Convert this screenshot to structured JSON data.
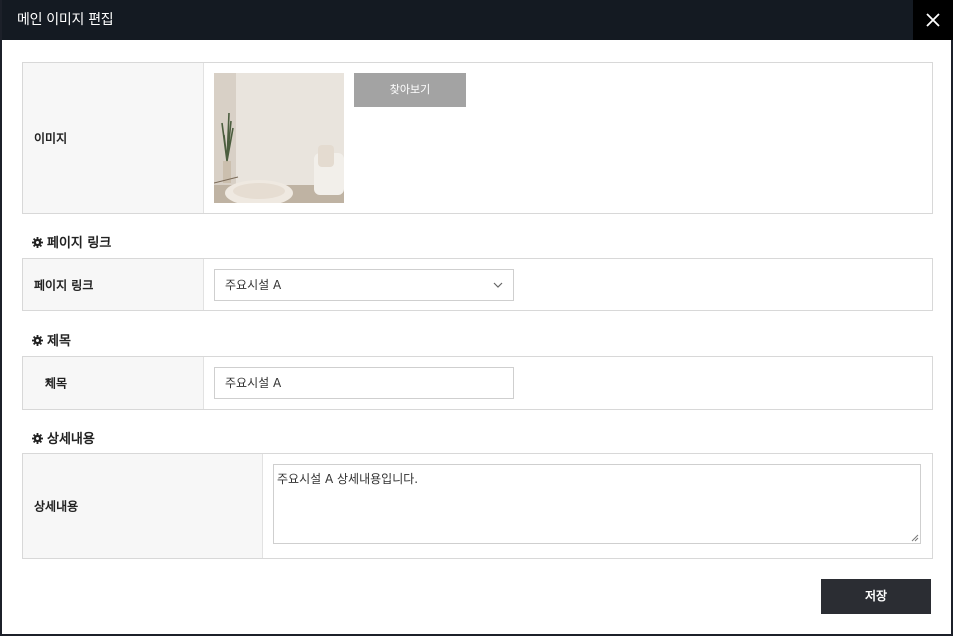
{
  "modal": {
    "title": "메인 이미지 편집",
    "close_icon": "close-icon"
  },
  "image_row": {
    "label": "이미지",
    "browse_label": "찾아보기"
  },
  "page_link_section": {
    "title": "페이지 링크",
    "label": "페이지 링크",
    "selected_value": "주요시설 A"
  },
  "title_section": {
    "title": "제목",
    "label": "제목",
    "required_mark": "*",
    "value": "주요시설 A"
  },
  "detail_section": {
    "title": "상세내용",
    "label": "상세내용",
    "value": "주요시설 A 상세내용입니다."
  },
  "footer": {
    "save_label": "저장"
  },
  "colors": {
    "header_bg": "#141a22",
    "save_bg": "#2b2d33",
    "browse_bg": "#a3a3a3",
    "required": "#e0161a"
  }
}
